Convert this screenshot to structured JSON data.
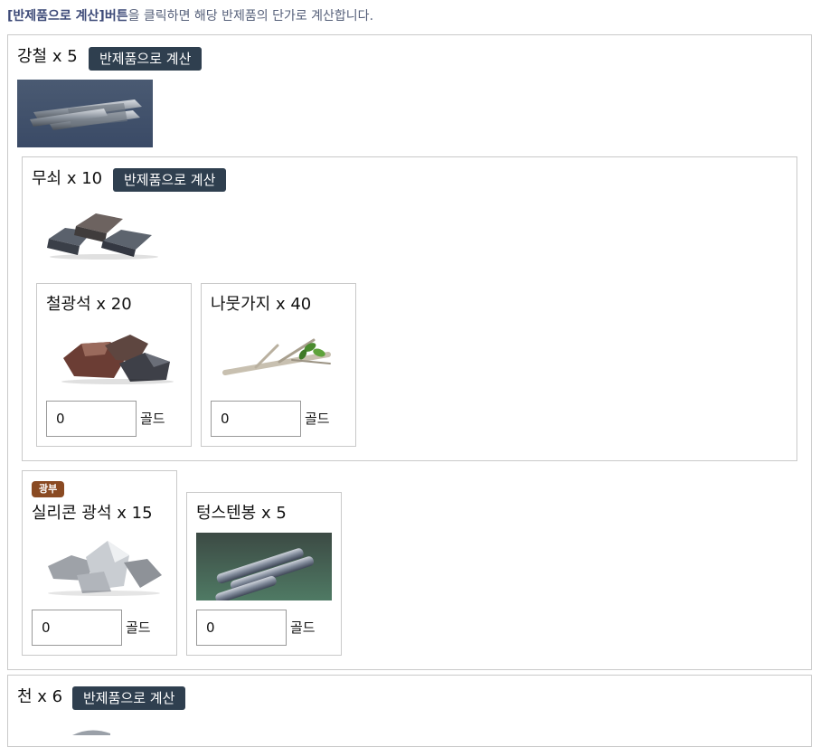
{
  "hint": {
    "highlight": "[반제품으로 계산]버튼",
    "rest": "을 클릭하면 해당 반제품의 단가로 계산합니다."
  },
  "calc_button_label": "반제품으로 계산",
  "unit_label": "골드",
  "steel": {
    "title": "강철 x 5",
    "image_icon": "steel-bars-icon"
  },
  "pig_iron": {
    "title": "무쇠 x 10",
    "image_icon": "iron-ingots-icon"
  },
  "iron_ore": {
    "title": "철광석 x 20",
    "price": "0",
    "image_icon": "iron-ore-icon"
  },
  "twig": {
    "title": "나뭇가지 x 40",
    "price": "0",
    "image_icon": "twig-icon"
  },
  "silicon_ore": {
    "badge": "광부",
    "title": "실리콘 광석 x 15",
    "price": "0",
    "image_icon": "silicon-ore-icon"
  },
  "tungsten_rod": {
    "title": "텅스텐봉 x 5",
    "price": "0",
    "image_icon": "tungsten-rods-icon"
  },
  "cloth": {
    "title": "천 x 6"
  },
  "colors": {
    "button_bg": "#2f3f4f",
    "badge_bg": "#8a4a22",
    "hint_highlight": "#3d4a78"
  }
}
